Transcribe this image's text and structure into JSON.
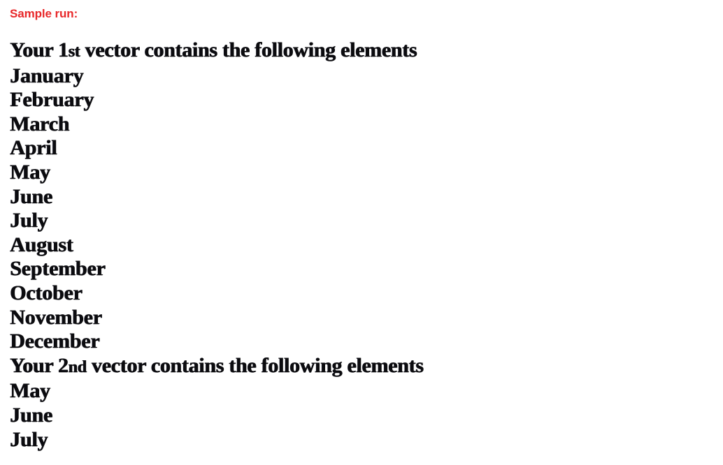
{
  "annotation": {
    "label": "Sample run:",
    "color": "#e8282a"
  },
  "console": {
    "background": "#ffffff",
    "text_color": "#0b0b0f",
    "lines": [
      {
        "kind": "header",
        "prefix": "Your ",
        "ordinal_number": "1",
        "ordinal_suffix": "st",
        "suffix": " vector contains the following elements"
      },
      {
        "kind": "item",
        "text": "January"
      },
      {
        "kind": "item",
        "text": "February"
      },
      {
        "kind": "item",
        "text": "March"
      },
      {
        "kind": "item",
        "text": "April"
      },
      {
        "kind": "item",
        "text": "May"
      },
      {
        "kind": "item",
        "text": "June"
      },
      {
        "kind": "item",
        "text": "July"
      },
      {
        "kind": "item",
        "text": "August"
      },
      {
        "kind": "item",
        "text": "September"
      },
      {
        "kind": "item",
        "text": "October"
      },
      {
        "kind": "item",
        "text": "November"
      },
      {
        "kind": "item",
        "text": "December"
      },
      {
        "kind": "header",
        "prefix": "Your ",
        "ordinal_number": "2",
        "ordinal_suffix": "nd",
        "suffix": " vector contains the following elements"
      },
      {
        "kind": "item",
        "text": "May"
      },
      {
        "kind": "item",
        "text": "June"
      },
      {
        "kind": "item",
        "text": "July"
      }
    ]
  }
}
